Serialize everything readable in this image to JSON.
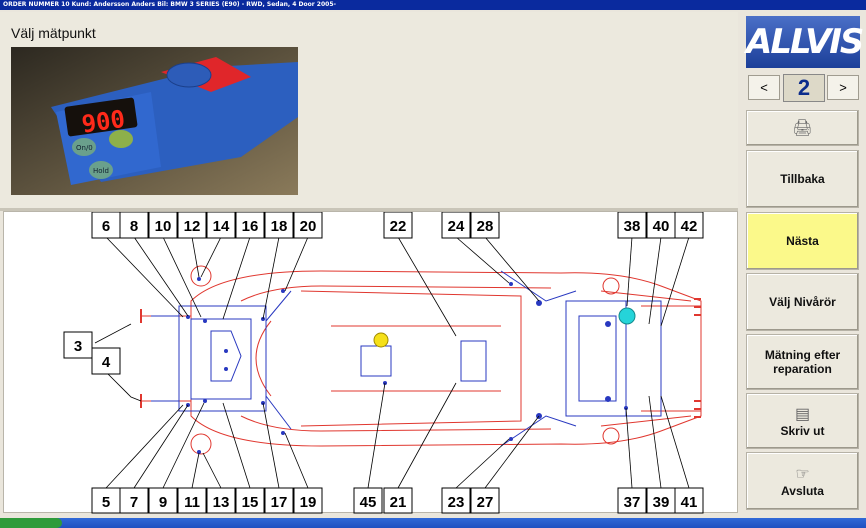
{
  "titlebar": {
    "text": "ORDER NUMMER  10    Kund: Andersson Anders    Bil: BMW  3 SERIES (E90) - RWD, Sedan, 4 Door  2005-"
  },
  "heading": "Välj mätpunkt",
  "device_display": "900",
  "device_buttons": {
    "left": "On/0",
    "center": "Hold"
  },
  "logo": "ALLVIS",
  "nav": {
    "prev": "<",
    "page": "2",
    "next": ">"
  },
  "buttons": {
    "print_icon": "printer-icon",
    "back": "Tillbaka",
    "next": "Nästa",
    "levels": "Välj Nivårör",
    "measure": "Mätning efter reparation",
    "print": "Skriv ut",
    "exit": "Avsluta"
  },
  "colors": {
    "chassis_red": "#e0372f",
    "frame_blue": "#2838c0",
    "highlight_yellow": "#f5e019",
    "highlight_cyan": "#25d4d9",
    "active_button": "#fbf98a"
  },
  "points_top": [
    "6",
    "8",
    "10",
    "12",
    "14",
    "16",
    "18",
    "20",
    "22",
    "24",
    "28",
    "38",
    "40",
    "42"
  ],
  "points_bottom": [
    "5",
    "7",
    "9",
    "11",
    "13",
    "15",
    "17",
    "19",
    "45",
    "21",
    "23",
    "27",
    "37",
    "39",
    "41"
  ],
  "points_left": [
    "3",
    "4"
  ]
}
